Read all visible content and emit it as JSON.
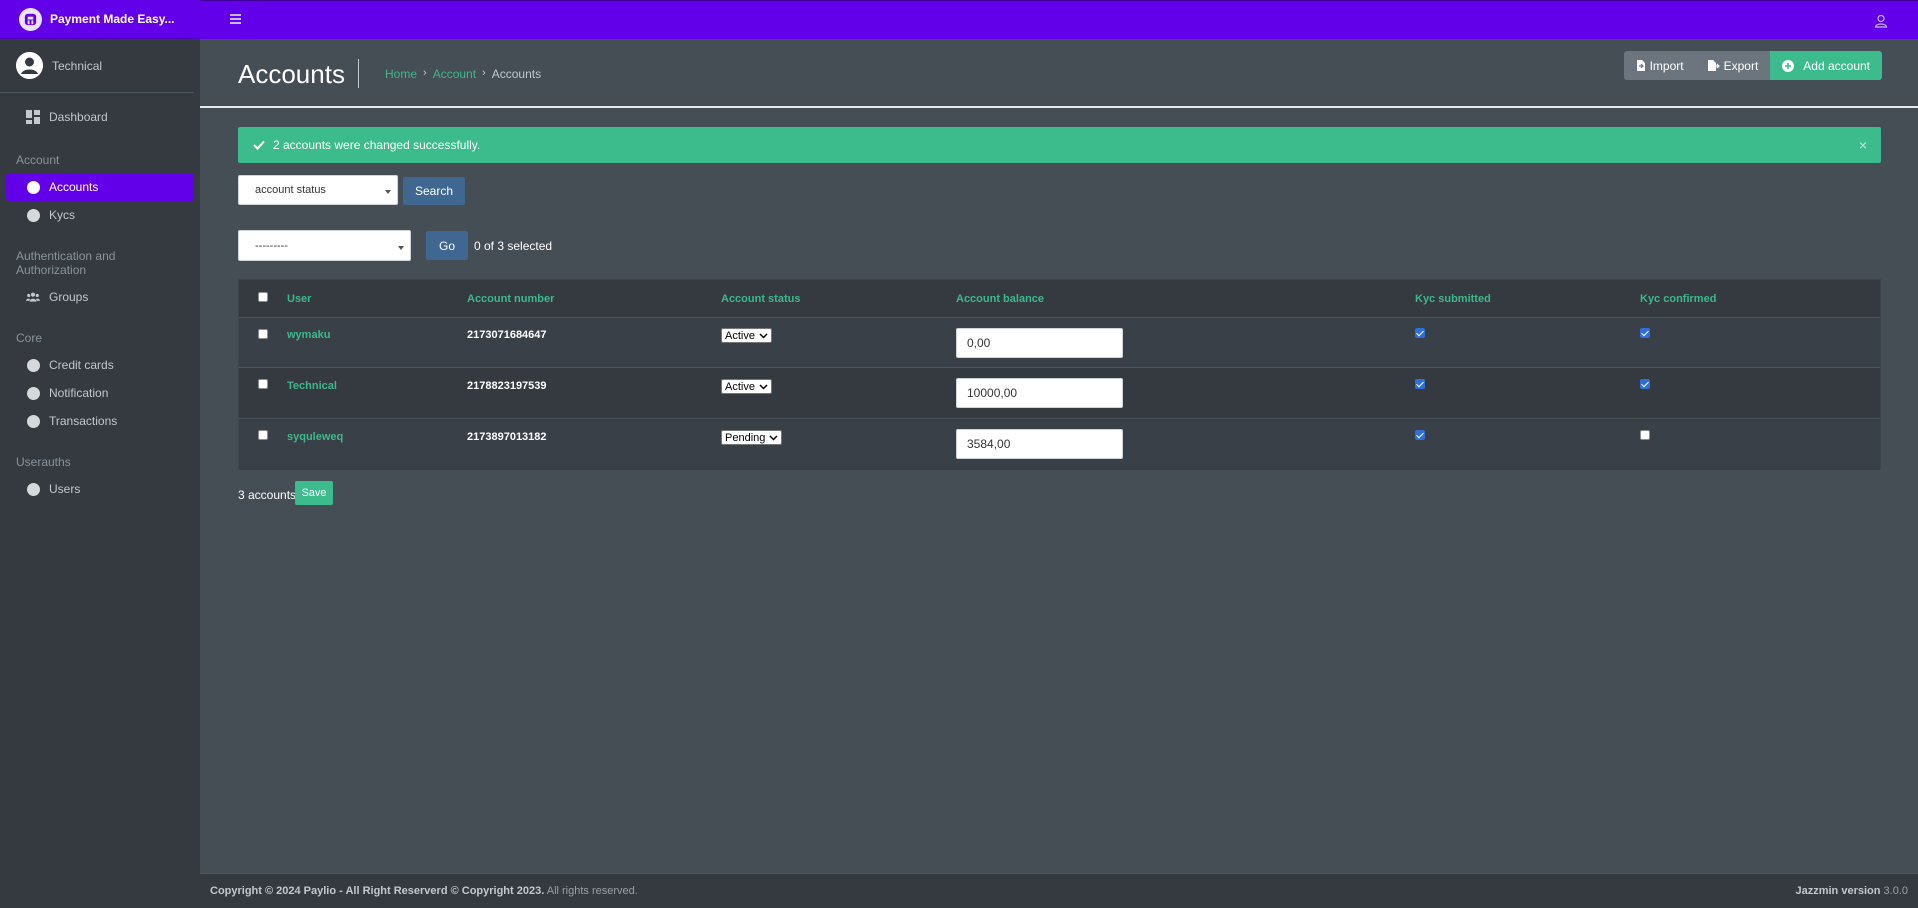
{
  "brand": {
    "name": "Payment Made Easy..."
  },
  "user_panel": {
    "name": "Technical"
  },
  "sidebar": {
    "dashboard": "Dashboard",
    "sections": [
      {
        "header": "Account",
        "items": [
          "Accounts",
          "Kycs"
        ]
      },
      {
        "header": "Authentication and Authorization",
        "items": [
          "Groups"
        ]
      },
      {
        "header": "Core",
        "items": [
          "Credit cards",
          "Notification",
          "Transactions"
        ]
      },
      {
        "header": "Userauths",
        "items": [
          "Users"
        ]
      }
    ],
    "active_item": "Accounts"
  },
  "page": {
    "title": "Accounts",
    "breadcrumb": [
      "Home",
      "Account",
      "Accounts"
    ],
    "breadcrumb_sep": "›",
    "buttons": {
      "import": "Import",
      "export": "Export",
      "add": "Add account"
    }
  },
  "alert": {
    "message": "2 accounts were changed successfully.",
    "close": "×"
  },
  "filter": {
    "select_value": "account status",
    "search_label": "Search"
  },
  "actions": {
    "select_value": "---------",
    "go_label": "Go",
    "selection_count": "0 of 3 selected"
  },
  "table": {
    "headers": [
      "User",
      "Account number",
      "Account status",
      "Account balance",
      "Kyc submitted",
      "Kyc confirmed"
    ],
    "rows": [
      {
        "user": "wymaku",
        "account_number": "2173071684647",
        "status": "Active",
        "balance": "0,00",
        "kyc_submitted": true,
        "kyc_confirmed": true
      },
      {
        "user": "Technical",
        "account_number": "2178823197539",
        "status": "Active",
        "balance": "10000,00",
        "kyc_submitted": true,
        "kyc_confirmed": true
      },
      {
        "user": "syquleweq",
        "account_number": "2173897013182",
        "status": "Pending",
        "balance": "3584,00",
        "kyc_submitted": true,
        "kyc_confirmed": false
      }
    ]
  },
  "result": {
    "count_text": "3 accounts",
    "save_label": "Save"
  },
  "footer": {
    "copyright_bold": "Copyright © 2024 Paylio - All Right Reserverd © Copyright 2023.",
    "copyright_rest": " All rights reserved.",
    "version_bold": "Jazzmin version",
    "version_num": " 3.0.0"
  },
  "colors": {
    "accent": "#6200ea",
    "success": "#3cbc8d",
    "link": "#3cb98b",
    "sidebar": "#343a40",
    "content": "#454d55"
  }
}
